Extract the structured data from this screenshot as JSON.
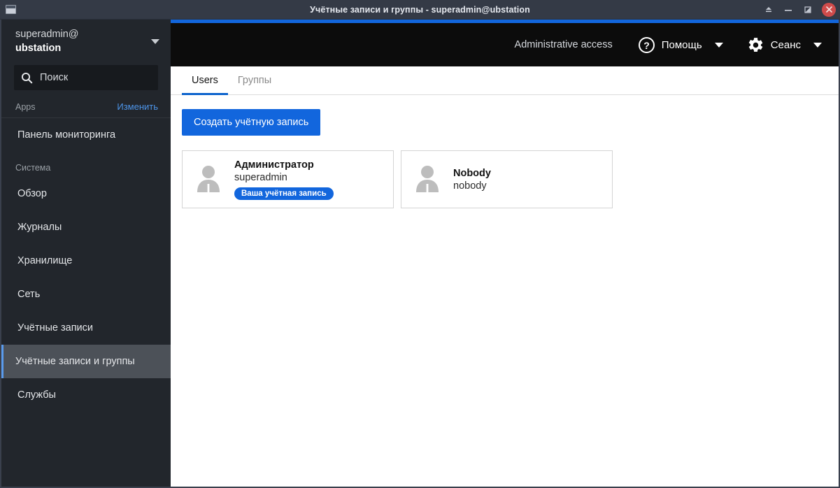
{
  "window": {
    "title": "Учётные записи и группы - superadmin@ubstation",
    "icon_name": "window-icon",
    "controls": {
      "shade_label": "Свернуть в заголовок",
      "minimize_label": "Свернуть",
      "maximize_label": "Развернуть",
      "close_label": "Закрыть"
    }
  },
  "sidebar": {
    "host": {
      "user": "superadmin@",
      "machine": "ubstation"
    },
    "search": {
      "placeholder": "Поиск",
      "value": ""
    },
    "apps_header": {
      "title": "Apps",
      "action": "Изменить"
    },
    "apps_items": [
      {
        "label": "Панель мониторинга",
        "active": false
      }
    ],
    "system_header": "Система",
    "system_items": [
      {
        "label": "Обзор",
        "active": false
      },
      {
        "label": "Журналы",
        "active": false
      },
      {
        "label": "Хранилище",
        "active": false
      },
      {
        "label": "Сеть",
        "active": false
      },
      {
        "label": "Учётные записи",
        "active": false
      },
      {
        "label": "Учётные записи и группы",
        "active": true
      },
      {
        "label": "Службы",
        "active": false
      }
    ]
  },
  "topbar": {
    "admin_access": "Administrative access",
    "help_label": "Помощь",
    "session_label": "Сеанс"
  },
  "tabs": [
    {
      "label": "Users",
      "active": true
    },
    {
      "label": "Группы",
      "active": false
    }
  ],
  "main": {
    "create_button": "Создать учётную запись",
    "users": [
      {
        "fullname": "Администратор",
        "login": "superadmin",
        "badge": "Ваша учётная запись"
      },
      {
        "fullname": "Nobody",
        "login": "nobody",
        "badge": ""
      }
    ]
  },
  "colors": {
    "accent_blue": "#1266dd",
    "tab_underline": "#0b62cc",
    "sidebar_bg": "#22262c",
    "titlebar_bg": "#343a46",
    "topbar_bg": "#0c0c0c",
    "close_red": "#cf4b4b",
    "link_blue": "#4d94e8"
  }
}
